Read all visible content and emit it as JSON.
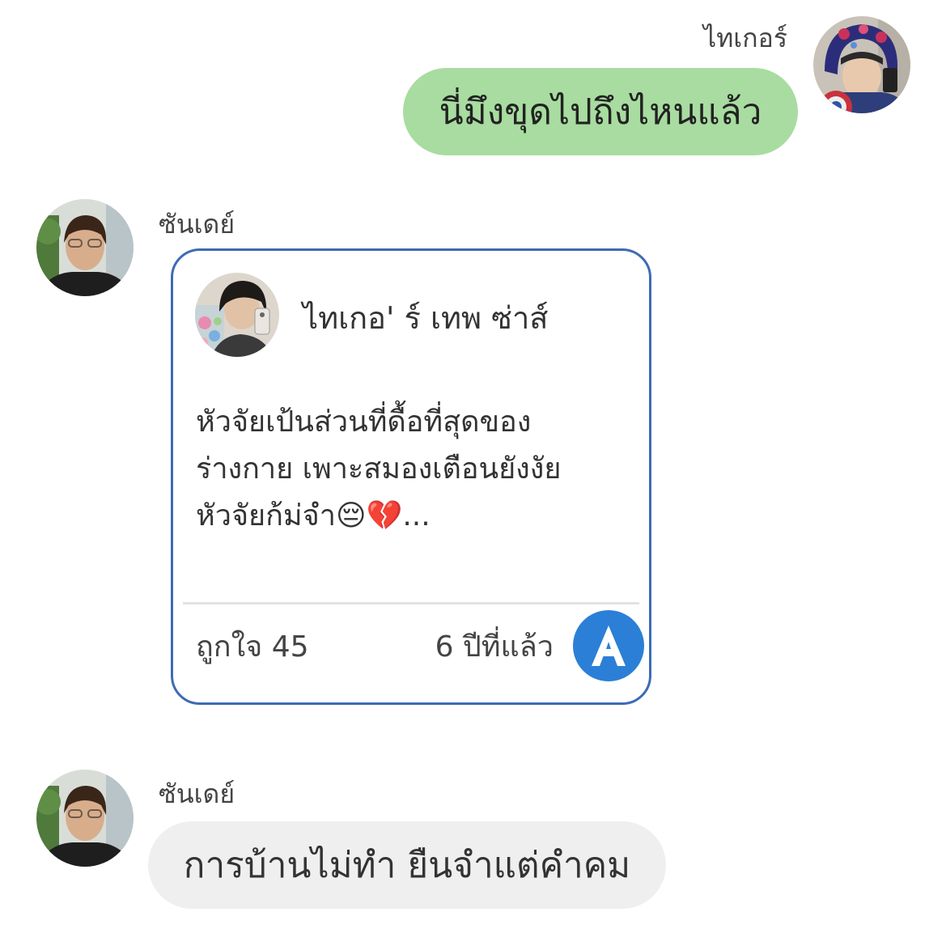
{
  "messages": [
    {
      "sender": "ไทเกอร์",
      "direction": "outgoing",
      "text": "นี่มึงขุดไปถึงไหนแล้ว"
    },
    {
      "sender": "ซันเดย์",
      "direction": "incoming",
      "shared_post": {
        "author": "ไทเกอ' ร์   เทพ ซ่าส์",
        "body_lines": [
          "หัวจัยเป้นส่วนที่ดื้อที่สุดของ",
          "ร่างกาย เพาะสมองเตือนยังงัย",
          "หัวจัยก้ม่จำ😔💔..."
        ],
        "likes": "ถูกใจ 45",
        "time": "6 ปีที่แล้ว",
        "app_icon": "letter-a-app-icon"
      }
    },
    {
      "sender": "ซันเดย์",
      "direction": "incoming",
      "text": "การบ้านไม่ทำ ยืนจำแต่คำคม"
    }
  ],
  "colors": {
    "outgoing_bubble": "#a8dca0",
    "incoming_bubble": "#efefef",
    "card_border": "#3d6bb5",
    "app_badge": "#2c7fd6"
  }
}
